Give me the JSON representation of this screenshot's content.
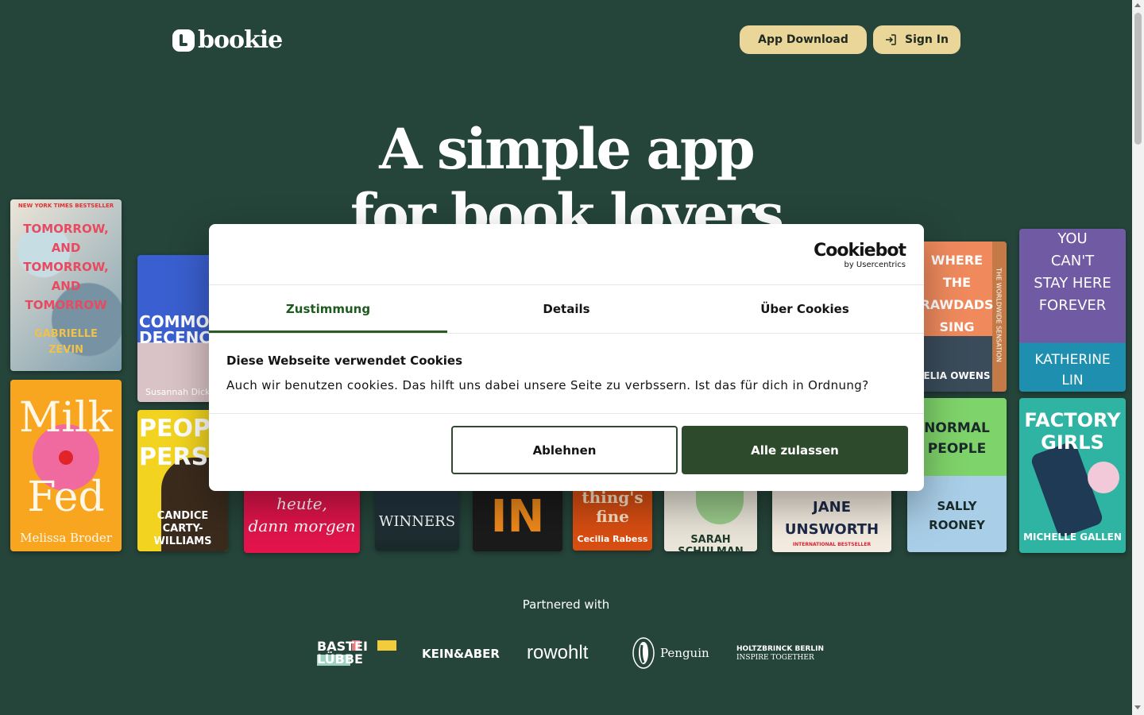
{
  "header": {
    "logo_text": "bookie",
    "app_download": "App Download",
    "sign_in": "Sign In"
  },
  "hero": {
    "line1": "A simple app",
    "line2": "for book lovers"
  },
  "books": [
    {
      "lines": [
        "TOMORROW,",
        "AND",
        "TOMORROW,",
        "AND",
        "TOMORROW"
      ],
      "author": "GABRIELLE ZEVIN",
      "top_text": "NEW YORK TIMES BESTSELLER"
    },
    {
      "lines": [
        "Milk",
        "Fed"
      ],
      "author": "Melissa Broder"
    },
    {
      "lines": [
        "COMMO",
        "DECENC"
      ],
      "author": "Susannah Dick"
    },
    {
      "lines": [
        "PEOPL",
        "PERSO"
      ],
      "author": "CANDICE CARTY-WILLIAMS"
    },
    {
      "lines": [
        "heute,",
        "dann morgen"
      ]
    },
    {
      "lines": [
        "WINNERS"
      ]
    },
    {
      "lines": [
        "IN"
      ]
    },
    {
      "lines": [
        "thing's",
        "fine"
      ],
      "author": "Cecilia Rabess"
    },
    {
      "lines": [],
      "author": "SARAH SCHULMAN"
    },
    {
      "lines": [
        "JANE",
        "UNSWORTH"
      ],
      "author": "INTERNATIONAL BESTSELLER"
    },
    {
      "lines": [
        "WHERE",
        "THE",
        "RAWDADS",
        "SING"
      ],
      "author": "ELIA OWENS",
      "side": "THE WORLDWIDE SENSATION"
    },
    {
      "lines": [
        "NORMAL",
        "PEOPLE"
      ],
      "author": "SALLY ROONEY"
    },
    {
      "lines": [
        "YOU",
        "CAN'T",
        "STAY HERE",
        "FOREVER"
      ],
      "author": "KATHERINE LIN"
    },
    {
      "lines": [
        "FACTORY",
        "GIRLS"
      ],
      "author": "MICHELLE GALLEN"
    }
  ],
  "cookie": {
    "brand_big": "Cookiebot",
    "brand_small": "by Usercentrics",
    "tabs": [
      "Zustimmung",
      "Details",
      "Über Cookies"
    ],
    "title": "Diese Webseite verwendet Cookies",
    "text": "Auch wir benutzen cookies. Das hilft uns dabei unsere Seite zu verbssern. Ist das für dich in Ordnung?",
    "reject": "Ablehnen",
    "accept": "Alle zulassen"
  },
  "partners": {
    "title": "Partnered with",
    "logos": [
      "BASTEI LÜBBE",
      "KEIN&ABER",
      "rowohlt",
      "Penguin",
      "HOLTZBRINCK BERLIN",
      "INSPIRE TOGETHER"
    ]
  },
  "colors": {
    "background": "#25443a",
    "button": "#ebd69a",
    "accept": "#2e4a2c"
  }
}
